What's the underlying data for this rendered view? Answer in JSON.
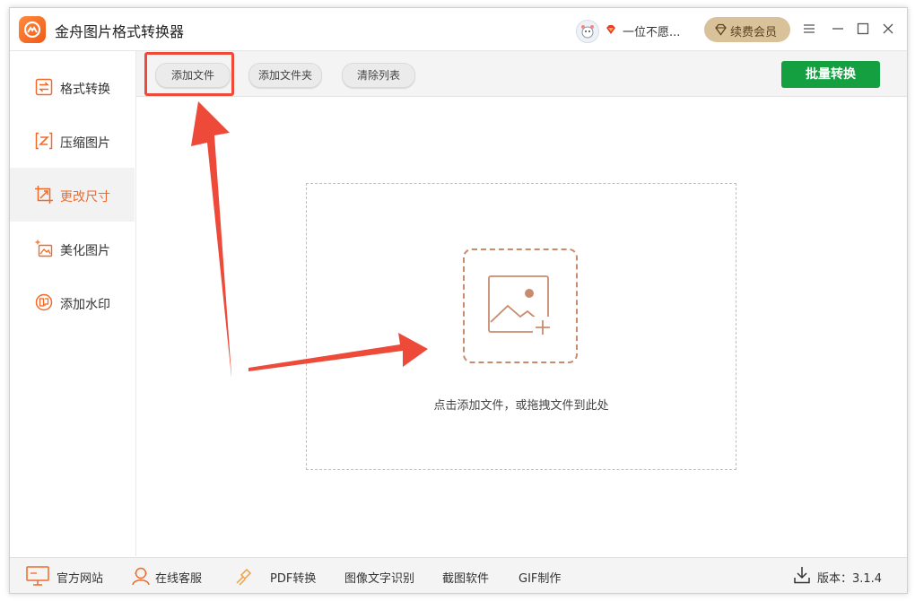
{
  "app": {
    "title": "金舟图片格式转换器"
  },
  "user": {
    "name": "一位不愿..."
  },
  "header": {
    "renew_label": "续费会员"
  },
  "sidebar": {
    "items": [
      {
        "label": "格式转换",
        "icon": "format-convert-icon"
      },
      {
        "label": "压缩图片",
        "icon": "compress-icon"
      },
      {
        "label": "更改尺寸",
        "icon": "resize-icon",
        "active": true
      },
      {
        "label": "美化图片",
        "icon": "beautify-icon"
      },
      {
        "label": "添加水印",
        "icon": "watermark-icon"
      }
    ]
  },
  "toolbar": {
    "add_file": "添加文件",
    "add_folder": "添加文件夹",
    "clear_list": "清除列表",
    "batch_convert": "批量转换"
  },
  "drop_zone": {
    "hint": "点击添加文件，或拖拽文件到此处"
  },
  "footer": {
    "website": "官方网站",
    "support": "在线客服",
    "pdf": "PDF转换",
    "ocr": "图像文字识别",
    "screenshot": "截图软件",
    "gif": "GIF制作",
    "version": "版本：3.1.4"
  },
  "colors": {
    "accent": "#f06a2a",
    "primary_button": "#14a040",
    "highlight": "#ee4a3a",
    "vip": "#d9c29a"
  }
}
